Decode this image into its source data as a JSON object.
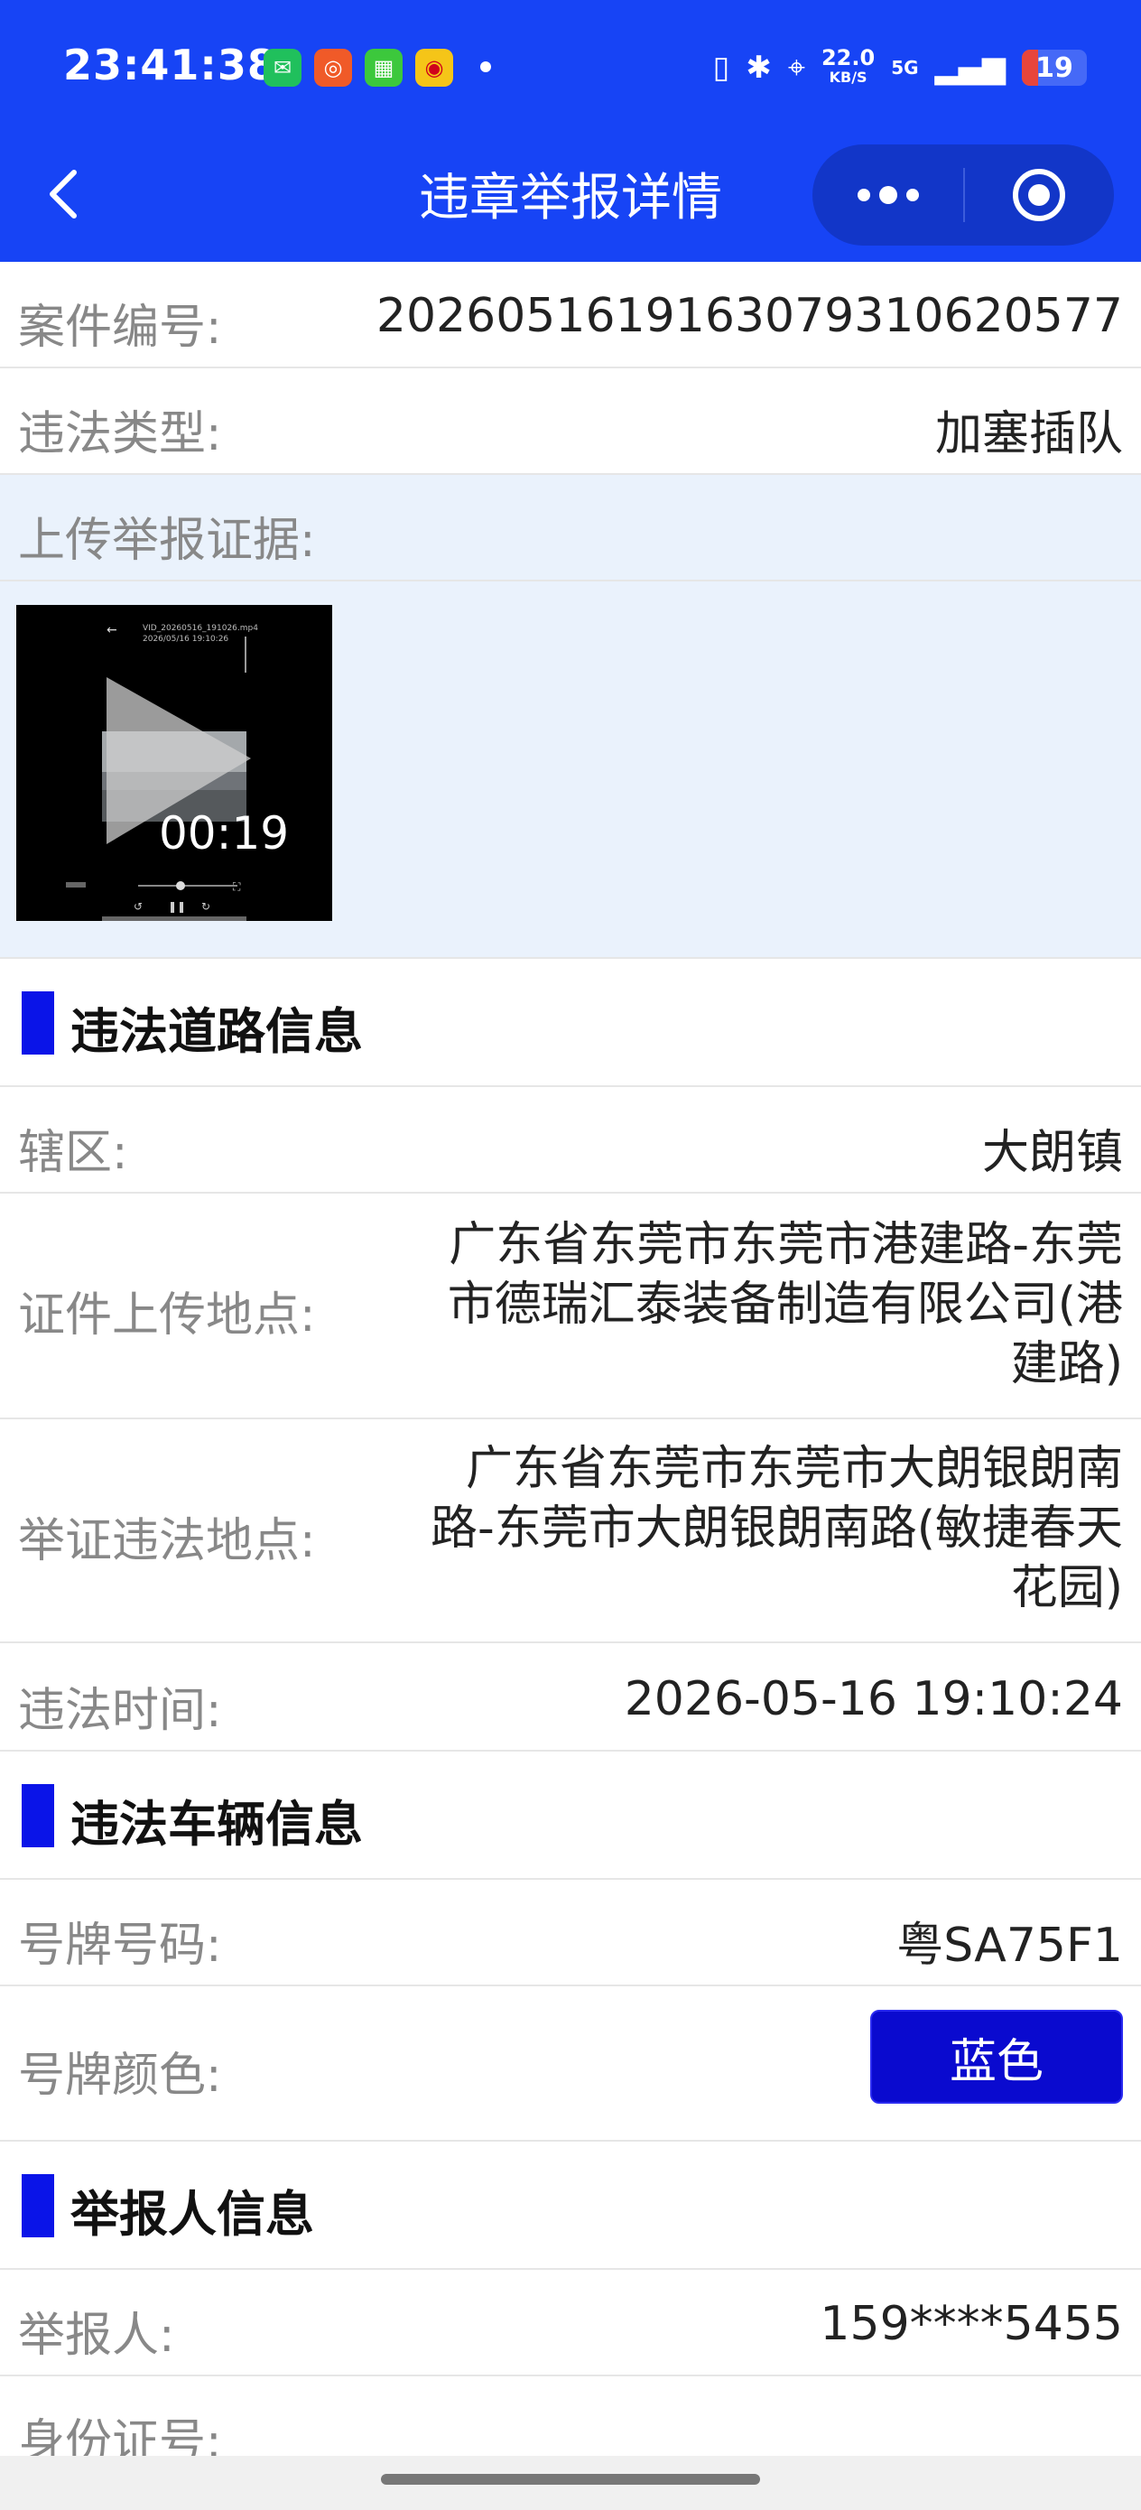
{
  "status_bar": {
    "time": "23:41:38",
    "speed_value": "22.0",
    "speed_unit": "KB/S",
    "network": "5G",
    "battery": "19",
    "app_icons": [
      "wechat-icon",
      "taobao-icon",
      "kuaiyin-icon",
      "weibo-icon"
    ]
  },
  "nav": {
    "title": "违章举报详情"
  },
  "case": {
    "number_label": "案件编号:",
    "number_value": "2026051619163079310620577",
    "type_label": "违法类型:",
    "type_value": "加塞插队",
    "evidence_label": "上传举报证据:",
    "video": {
      "duration": "00:19",
      "header_line1": "VID_20260516_191026.mp4",
      "header_line2": "2026/05/16 19:10:26"
    }
  },
  "road_section": {
    "title": "违法道路信息",
    "district_label": "辖区:",
    "district_value": "大朗镇",
    "upload_loc_label": "证件上传地点:",
    "upload_loc_lines": [
      "广东省东莞市东莞市港建路-东莞",
      "市德瑞汇泰装备制造有限公司(港",
      "建路)"
    ],
    "evidence_loc_label": "举证违法地点:",
    "evidence_loc_lines": [
      "广东省东莞市东莞市大朗银朗南",
      "路-东莞市大朗银朗南路(敏捷春天",
      "花园)"
    ],
    "time_label": "违法时间:",
    "time_value": "2026-05-16 19:10:24"
  },
  "vehicle_section": {
    "title": "违法车辆信息",
    "plate_label": "号牌号码:",
    "plate_value": "粤SA75F1",
    "color_label": "号牌颜色:",
    "color_value": "蓝色",
    "plate_color_hex": "#0A0ACF"
  },
  "reporter_section": {
    "title": "举报人信息",
    "reporter_label": "举报人:",
    "reporter_value": "159****5455",
    "id_label": "身份证号:",
    "id_value": ""
  },
  "colors": {
    "header_blue": "#1744F5",
    "section_bar": "#0A14E8",
    "evidence_bg": "#EAF2FC"
  }
}
